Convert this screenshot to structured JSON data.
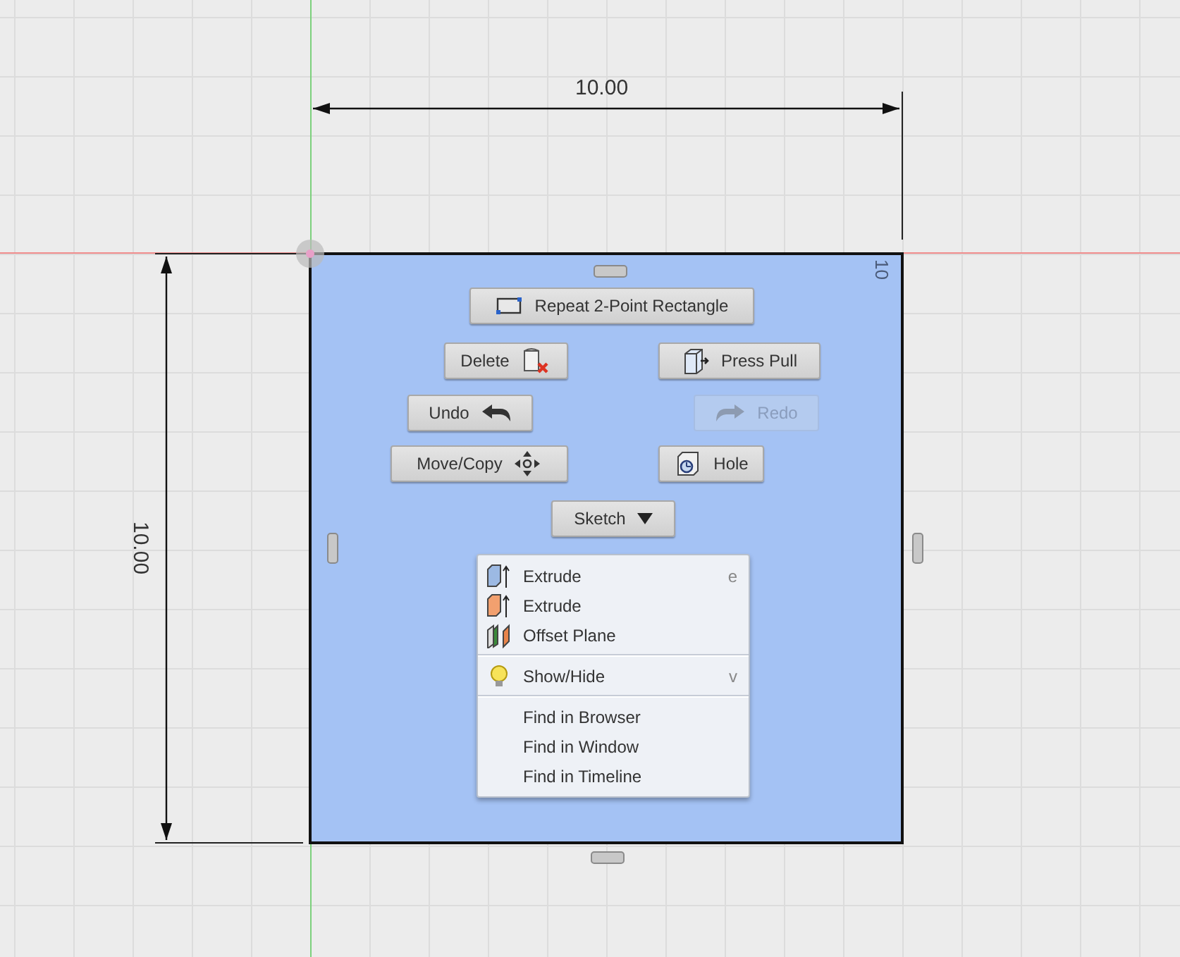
{
  "canvas": {
    "width_dimension": "10.00",
    "height_dimension": "10.00",
    "edge_label": "10"
  },
  "marking_menu": {
    "buttons": [
      {
        "label": "Repeat 2-Point Rectangle",
        "disabled": false
      },
      {
        "label": "Delete",
        "disabled": false
      },
      {
        "label": "Press Pull",
        "disabled": false
      },
      {
        "label": "Undo",
        "disabled": false
      },
      {
        "label": "Redo",
        "disabled": true
      },
      {
        "label": "Move/Copy",
        "disabled": false
      },
      {
        "label": "Hole",
        "disabled": false
      },
      {
        "label": "Sketch",
        "disabled": false
      }
    ]
  },
  "context_menu": {
    "groups": [
      [
        {
          "label": "Extrude",
          "shortcut": "e"
        },
        {
          "label": "Extrude"
        },
        {
          "label": "Offset Plane"
        }
      ],
      [
        {
          "label": "Show/Hide",
          "shortcut": "v"
        }
      ],
      [
        {
          "label": "Find in Browser"
        },
        {
          "label": "Find in Window"
        },
        {
          "label": "Find in Timeline"
        }
      ]
    ]
  }
}
